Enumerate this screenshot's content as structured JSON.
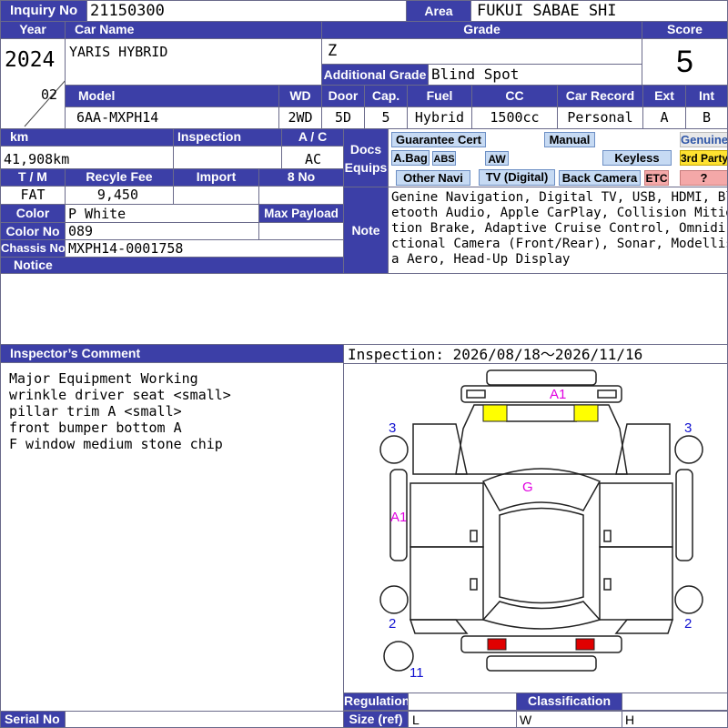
{
  "header": {
    "inquiry_label": "Inquiry No",
    "inquiry_no": "21150300",
    "area_label": "Area",
    "area": "FUKUI SABAE SHI"
  },
  "vehicle": {
    "year_label": "Year",
    "year": "2024",
    "month": "02",
    "car_name_label": "Car Name",
    "car_name": "YARIS HYBRID",
    "grade_label": "Grade",
    "grade": "Z",
    "additional_grade_label": "Additional Grade",
    "additional_grade": "Blind Spot",
    "score_label": "Score",
    "score": "5",
    "model_label": "Model",
    "model": "6AA-MXPH14",
    "wd_label": "WD",
    "wd": "2WD",
    "door_label": "Door",
    "door": "5D",
    "cap_label": "Cap.",
    "cap": "5",
    "fuel_label": "Fuel",
    "fuel": "Hybrid",
    "cc_label": "CC",
    "cc": "1500cc",
    "car_record_label": "Car Record",
    "car_record": "Personal",
    "ext_label": "Ext",
    "ext": "A",
    "int_label": "Int",
    "int": "B"
  },
  "details": {
    "km_label": "km",
    "km": "41,908km",
    "inspection_label": "Inspection",
    "inspection": "",
    "ac_label": "A / C",
    "ac": "AC",
    "tm_label": "T / M",
    "tm": "FAT",
    "recycle_label": "Recyle Fee",
    "recycle": "9,450",
    "import_label": "Import",
    "import": "",
    "eight_label": "8 No",
    "eight": "",
    "color_label": "Color",
    "color": "P White",
    "max_payload_label": "Max Payload",
    "max_payload": "",
    "color_no_label": "Color No",
    "color_no": "089",
    "chassis_label": "Chassis No",
    "chassis": "MXPH14-0001758",
    "notice_label": "Notice",
    "notice": ""
  },
  "docs": {
    "label_line1": "Docs",
    "label_line2": "Equips",
    "guarantee": "Guarantee Cert",
    "manual": "Manual",
    "genuine": "Genuine",
    "abag": "A.Bag",
    "abs": "ABS",
    "aw": "AW",
    "keyless": "Keyless",
    "third_party": "3rd Party",
    "other_navi": "Other Navi",
    "tv": "TV (Digital)",
    "back_camera": "Back Camera",
    "etc": "ETC",
    "unknown": "?"
  },
  "note": {
    "label": "Note",
    "lines": [
      "Genine Navigation, Digital TV, USB, HDMI, Blu",
      "etooth Audio, Apple CarPlay, Collision Mitiga",
      "tion Brake, Adaptive Cruise Control, Omnidire",
      "ctional Camera (Front/Rear), Sonar, Modellist",
      "a Aero, Head-Up Display"
    ]
  },
  "comment": {
    "label": "Inspector’s Comment",
    "lines": [
      "Major Equipment Working",
      "wrinkle driver seat <small>",
      "pillar trim A <small>",
      "front bumper bottom A",
      "F window medium stone chip"
    ]
  },
  "inspection_period": "Inspection: 2026/08/18〜2026/11/16",
  "diagram": {
    "marks": {
      "a1_front": "A1",
      "g": "G",
      "a1_side": "A1",
      "three_left": "3",
      "three_right": "3",
      "two_left": "2",
      "two_right": "2",
      "eleven": "11"
    },
    "colors": {
      "highlight": "#ffff00",
      "tail_light": "#e00000",
      "blue_mark": "#1212d0",
      "magenta_mark": "#e000e0"
    }
  },
  "footer": {
    "serial_label": "Serial No",
    "serial": "",
    "regulation_label": "Regulation",
    "size_label": "Size (ref)",
    "classification_label": "Classification",
    "l_label": "L",
    "w_label": "W",
    "h_label": "H"
  },
  "colors": {
    "header_bg": "#3c3fa7",
    "equip_bg": "#c6daf3"
  }
}
